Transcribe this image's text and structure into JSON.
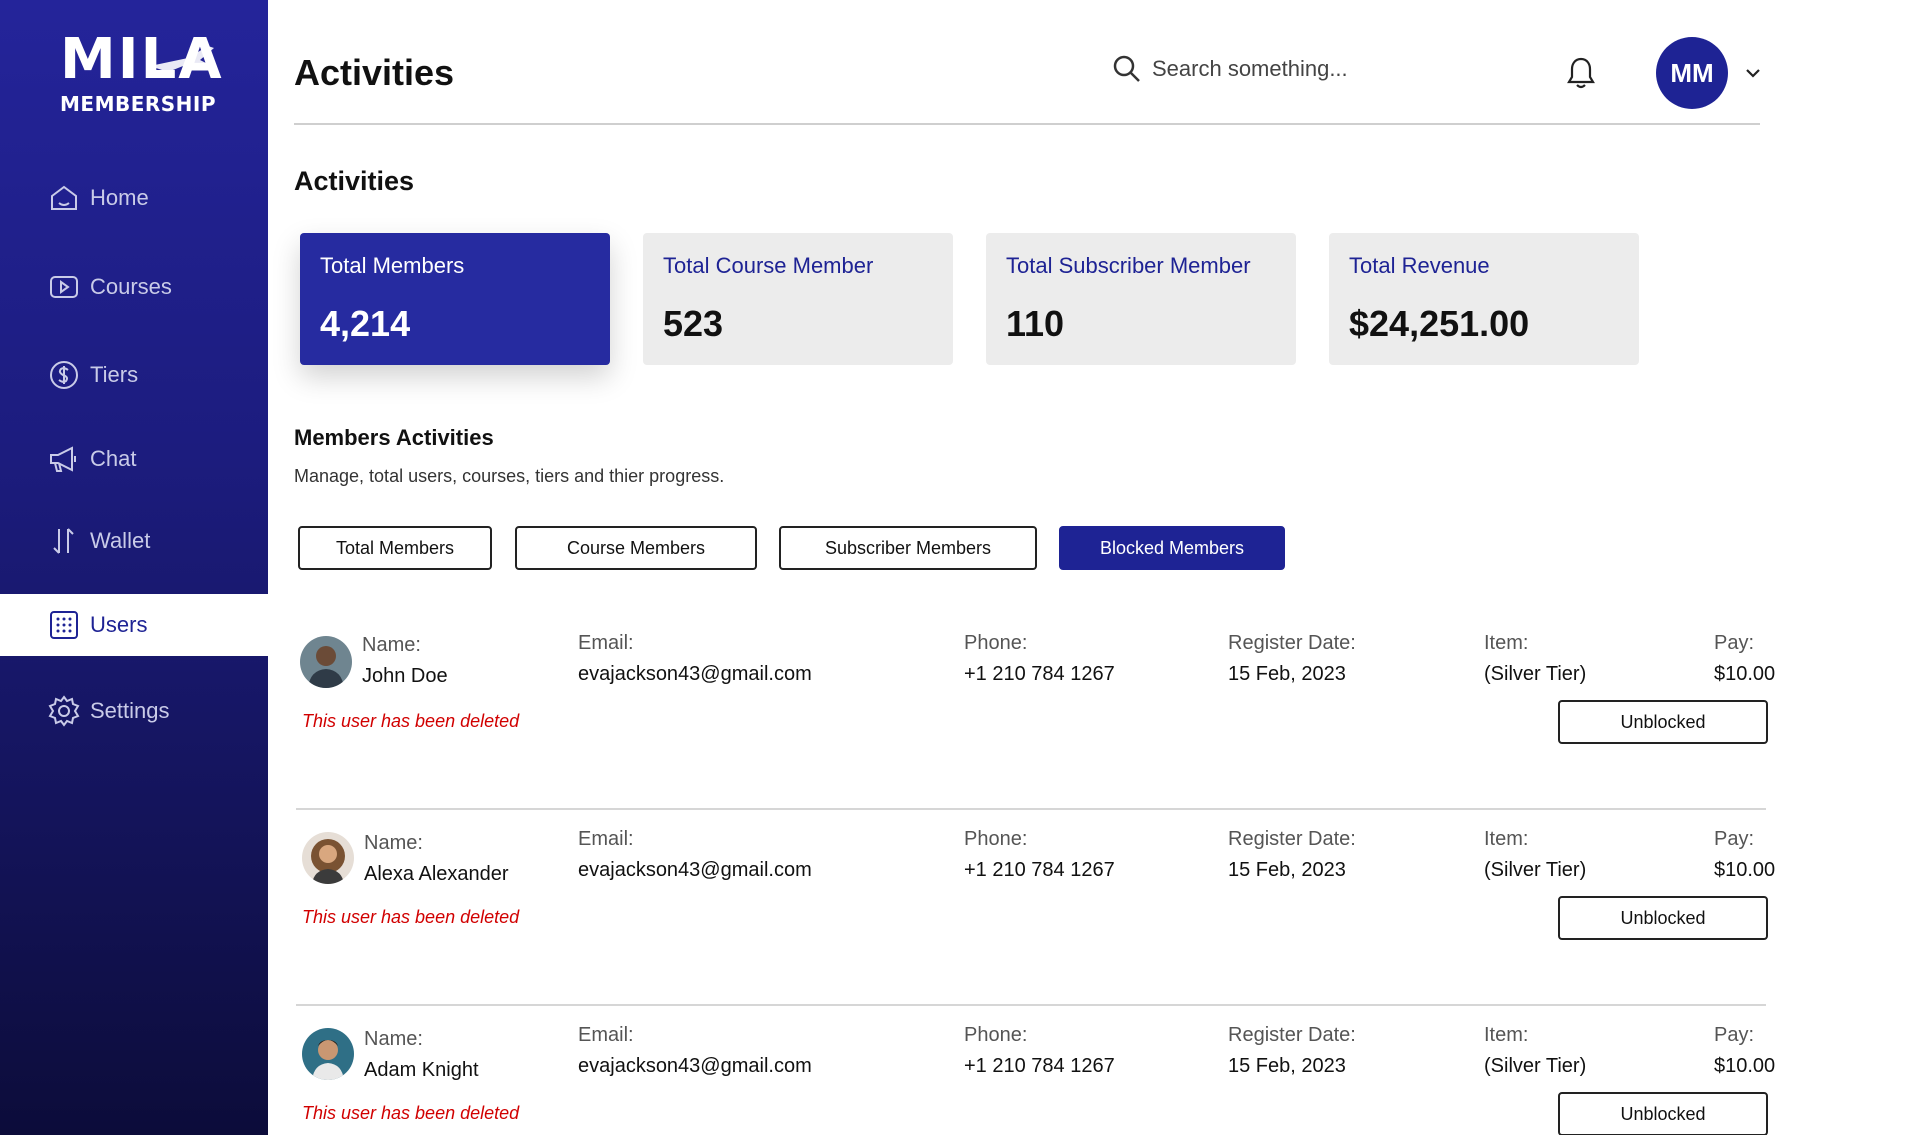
{
  "brand": {
    "logo_text": "MILA",
    "logo_sub": "MEMBERSHIP"
  },
  "sidebar": {
    "items": [
      {
        "label": "Home",
        "icon": "home-icon"
      },
      {
        "label": "Courses",
        "icon": "play-icon"
      },
      {
        "label": "Tiers",
        "icon": "dollar-icon"
      },
      {
        "label": "Chat",
        "icon": "megaphone-icon"
      },
      {
        "label": "Wallet",
        "icon": "transfer-icon"
      },
      {
        "label": "Users",
        "icon": "users-grid-icon",
        "active": true
      },
      {
        "label": "Settings",
        "icon": "gear-icon"
      }
    ]
  },
  "header": {
    "title": "Activities",
    "search_placeholder": "Search something...",
    "user_initials": "MM"
  },
  "activities": {
    "title": "Activities",
    "cards": [
      {
        "label": "Total Members",
        "value": "4,214",
        "active": true
      },
      {
        "label": "Total Course Member",
        "value": "523"
      },
      {
        "label": "Total Subscriber Member",
        "value": "110"
      },
      {
        "label": "Total Revenue",
        "value": "$24,251.00"
      }
    ]
  },
  "members_activities": {
    "title": "Members Activities",
    "subtitle": "Manage, total users, courses, tiers and thier progress.",
    "filters": [
      {
        "label": "Total Members"
      },
      {
        "label": "Course Members"
      },
      {
        "label": "Subscriber Members"
      },
      {
        "label": "Blocked Members",
        "active": true
      }
    ]
  },
  "member_labels": {
    "name": "Name:",
    "email": "Email:",
    "phone": "Phone:",
    "register": "Register Date:",
    "item": "Item:",
    "pay": "Pay:",
    "deleted_note": "This user has been deleted",
    "action": "Unblocked"
  },
  "members": [
    {
      "name": "John Doe",
      "email": "evajackson43@gmail.com",
      "phone": "+1 210 784 1267",
      "register_date": "15 Feb, 2023",
      "item": "(Silver Tier)",
      "pay": "$10.00"
    },
    {
      "name": "Alexa Alexander",
      "email": "evajackson43@gmail.com",
      "phone": "+1 210 784 1267",
      "register_date": "15 Feb, 2023",
      "item": "(Silver Tier)",
      "pay": "$10.00"
    },
    {
      "name": "Adam Knight",
      "email": "evajackson43@gmail.com",
      "phone": "+1 210 784 1267",
      "register_date": "15 Feb, 2023",
      "item": "(Silver Tier)",
      "pay": "$10.00"
    }
  ],
  "colors": {
    "primary": "#1e2394",
    "sidebar_dark": "#0c0c3a",
    "danger": "#d10000",
    "card_bg": "#ececec"
  }
}
